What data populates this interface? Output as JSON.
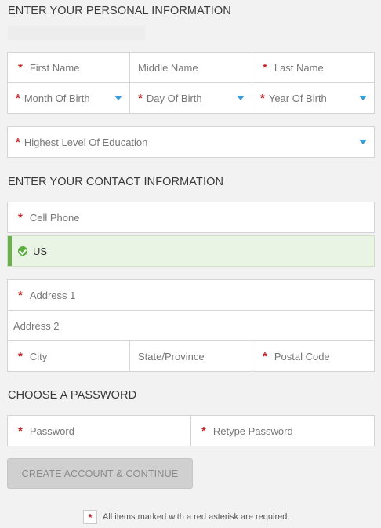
{
  "sections": {
    "personal": "ENTER YOUR PERSONAL INFORMATION",
    "contact": "ENTER YOUR CONTACT INFORMATION",
    "password": "CHOOSE A PASSWORD"
  },
  "personal": {
    "first_name": "First Name",
    "middle_name": "Middle Name",
    "last_name": "Last Name",
    "month_of_birth": "Month Of Birth",
    "day_of_birth": "Day Of Birth",
    "year_of_birth": "Year Of Birth",
    "education": "Highest Level Of Education"
  },
  "contact": {
    "cell_phone": "Cell Phone",
    "country": "US",
    "address1": "Address 1",
    "address2": "Address 2",
    "city": "City",
    "state": "State/Province",
    "postal_code": "Postal Code"
  },
  "password": {
    "password": "Password",
    "retype": "Retype Password"
  },
  "submit_label": "CREATE ACCOUNT & CONTINUE",
  "required_note": "All items marked with a red asterisk are required.",
  "required_marker": "*",
  "colors": {
    "asterisk": "#c0282b",
    "caret": "#3a9bd5",
    "success": "#5cae40"
  }
}
